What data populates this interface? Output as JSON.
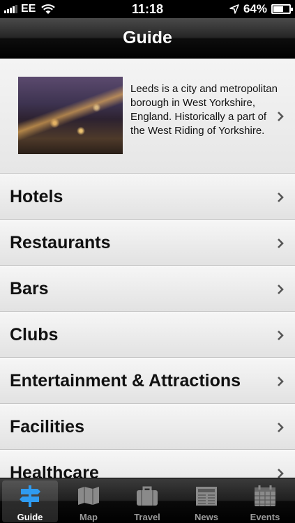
{
  "status_bar": {
    "carrier": "EE",
    "time": "11:18",
    "battery_percent_label": "64%",
    "battery_level": 0.64
  },
  "nav": {
    "title": "Guide"
  },
  "intro": {
    "text": "Leeds is a city and metropolitan borough in West Yorkshire, England. Historically a part of the West Riding of Yorkshire."
  },
  "list": [
    {
      "label": "Hotels"
    },
    {
      "label": "Restaurants"
    },
    {
      "label": "Bars"
    },
    {
      "label": "Clubs"
    },
    {
      "label": "Entertainment & Attractions"
    },
    {
      "label": "Facilities"
    },
    {
      "label": "Healthcare"
    }
  ],
  "tabs": [
    {
      "label": "Guide",
      "icon": "signpost-icon",
      "active": true
    },
    {
      "label": "Map",
      "icon": "map-icon",
      "active": false
    },
    {
      "label": "Travel",
      "icon": "suitcase-icon",
      "active": false
    },
    {
      "label": "News",
      "icon": "newspaper-icon",
      "active": false
    },
    {
      "label": "Events",
      "icon": "calendar-icon",
      "active": false
    }
  ],
  "colors": {
    "active_tab_icon": "#2f9bf0",
    "inactive_tab": "#9a9a9a"
  }
}
